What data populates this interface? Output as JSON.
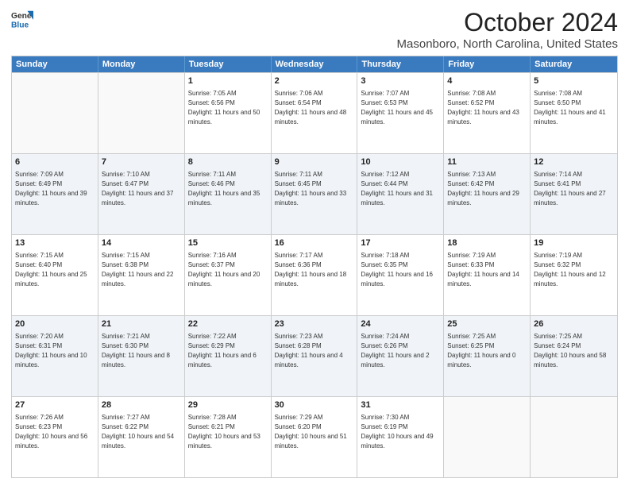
{
  "logo": {
    "general": "General",
    "blue": "Blue"
  },
  "title": "October 2024",
  "subtitle": "Masonboro, North Carolina, United States",
  "days": [
    "Sunday",
    "Monday",
    "Tuesday",
    "Wednesday",
    "Thursday",
    "Friday",
    "Saturday"
  ],
  "weeks": [
    [
      {
        "day": "",
        "sunrise": "",
        "sunset": "",
        "daylight": ""
      },
      {
        "day": "",
        "sunrise": "",
        "sunset": "",
        "daylight": ""
      },
      {
        "day": "1",
        "sunrise": "Sunrise: 7:05 AM",
        "sunset": "Sunset: 6:56 PM",
        "daylight": "Daylight: 11 hours and 50 minutes."
      },
      {
        "day": "2",
        "sunrise": "Sunrise: 7:06 AM",
        "sunset": "Sunset: 6:54 PM",
        "daylight": "Daylight: 11 hours and 48 minutes."
      },
      {
        "day": "3",
        "sunrise": "Sunrise: 7:07 AM",
        "sunset": "Sunset: 6:53 PM",
        "daylight": "Daylight: 11 hours and 45 minutes."
      },
      {
        "day": "4",
        "sunrise": "Sunrise: 7:08 AM",
        "sunset": "Sunset: 6:52 PM",
        "daylight": "Daylight: 11 hours and 43 minutes."
      },
      {
        "day": "5",
        "sunrise": "Sunrise: 7:08 AM",
        "sunset": "Sunset: 6:50 PM",
        "daylight": "Daylight: 11 hours and 41 minutes."
      }
    ],
    [
      {
        "day": "6",
        "sunrise": "Sunrise: 7:09 AM",
        "sunset": "Sunset: 6:49 PM",
        "daylight": "Daylight: 11 hours and 39 minutes."
      },
      {
        "day": "7",
        "sunrise": "Sunrise: 7:10 AM",
        "sunset": "Sunset: 6:47 PM",
        "daylight": "Daylight: 11 hours and 37 minutes."
      },
      {
        "day": "8",
        "sunrise": "Sunrise: 7:11 AM",
        "sunset": "Sunset: 6:46 PM",
        "daylight": "Daylight: 11 hours and 35 minutes."
      },
      {
        "day": "9",
        "sunrise": "Sunrise: 7:11 AM",
        "sunset": "Sunset: 6:45 PM",
        "daylight": "Daylight: 11 hours and 33 minutes."
      },
      {
        "day": "10",
        "sunrise": "Sunrise: 7:12 AM",
        "sunset": "Sunset: 6:44 PM",
        "daylight": "Daylight: 11 hours and 31 minutes."
      },
      {
        "day": "11",
        "sunrise": "Sunrise: 7:13 AM",
        "sunset": "Sunset: 6:42 PM",
        "daylight": "Daylight: 11 hours and 29 minutes."
      },
      {
        "day": "12",
        "sunrise": "Sunrise: 7:14 AM",
        "sunset": "Sunset: 6:41 PM",
        "daylight": "Daylight: 11 hours and 27 minutes."
      }
    ],
    [
      {
        "day": "13",
        "sunrise": "Sunrise: 7:15 AM",
        "sunset": "Sunset: 6:40 PM",
        "daylight": "Daylight: 11 hours and 25 minutes."
      },
      {
        "day": "14",
        "sunrise": "Sunrise: 7:15 AM",
        "sunset": "Sunset: 6:38 PM",
        "daylight": "Daylight: 11 hours and 22 minutes."
      },
      {
        "day": "15",
        "sunrise": "Sunrise: 7:16 AM",
        "sunset": "Sunset: 6:37 PM",
        "daylight": "Daylight: 11 hours and 20 minutes."
      },
      {
        "day": "16",
        "sunrise": "Sunrise: 7:17 AM",
        "sunset": "Sunset: 6:36 PM",
        "daylight": "Daylight: 11 hours and 18 minutes."
      },
      {
        "day": "17",
        "sunrise": "Sunrise: 7:18 AM",
        "sunset": "Sunset: 6:35 PM",
        "daylight": "Daylight: 11 hours and 16 minutes."
      },
      {
        "day": "18",
        "sunrise": "Sunrise: 7:19 AM",
        "sunset": "Sunset: 6:33 PM",
        "daylight": "Daylight: 11 hours and 14 minutes."
      },
      {
        "day": "19",
        "sunrise": "Sunrise: 7:19 AM",
        "sunset": "Sunset: 6:32 PM",
        "daylight": "Daylight: 11 hours and 12 minutes."
      }
    ],
    [
      {
        "day": "20",
        "sunrise": "Sunrise: 7:20 AM",
        "sunset": "Sunset: 6:31 PM",
        "daylight": "Daylight: 11 hours and 10 minutes."
      },
      {
        "day": "21",
        "sunrise": "Sunrise: 7:21 AM",
        "sunset": "Sunset: 6:30 PM",
        "daylight": "Daylight: 11 hours and 8 minutes."
      },
      {
        "day": "22",
        "sunrise": "Sunrise: 7:22 AM",
        "sunset": "Sunset: 6:29 PM",
        "daylight": "Daylight: 11 hours and 6 minutes."
      },
      {
        "day": "23",
        "sunrise": "Sunrise: 7:23 AM",
        "sunset": "Sunset: 6:28 PM",
        "daylight": "Daylight: 11 hours and 4 minutes."
      },
      {
        "day": "24",
        "sunrise": "Sunrise: 7:24 AM",
        "sunset": "Sunset: 6:26 PM",
        "daylight": "Daylight: 11 hours and 2 minutes."
      },
      {
        "day": "25",
        "sunrise": "Sunrise: 7:25 AM",
        "sunset": "Sunset: 6:25 PM",
        "daylight": "Daylight: 11 hours and 0 minutes."
      },
      {
        "day": "26",
        "sunrise": "Sunrise: 7:25 AM",
        "sunset": "Sunset: 6:24 PM",
        "daylight": "Daylight: 10 hours and 58 minutes."
      }
    ],
    [
      {
        "day": "27",
        "sunrise": "Sunrise: 7:26 AM",
        "sunset": "Sunset: 6:23 PM",
        "daylight": "Daylight: 10 hours and 56 minutes."
      },
      {
        "day": "28",
        "sunrise": "Sunrise: 7:27 AM",
        "sunset": "Sunset: 6:22 PM",
        "daylight": "Daylight: 10 hours and 54 minutes."
      },
      {
        "day": "29",
        "sunrise": "Sunrise: 7:28 AM",
        "sunset": "Sunset: 6:21 PM",
        "daylight": "Daylight: 10 hours and 53 minutes."
      },
      {
        "day": "30",
        "sunrise": "Sunrise: 7:29 AM",
        "sunset": "Sunset: 6:20 PM",
        "daylight": "Daylight: 10 hours and 51 minutes."
      },
      {
        "day": "31",
        "sunrise": "Sunrise: 7:30 AM",
        "sunset": "Sunset: 6:19 PM",
        "daylight": "Daylight: 10 hours and 49 minutes."
      },
      {
        "day": "",
        "sunrise": "",
        "sunset": "",
        "daylight": ""
      },
      {
        "day": "",
        "sunrise": "",
        "sunset": "",
        "daylight": ""
      }
    ]
  ]
}
